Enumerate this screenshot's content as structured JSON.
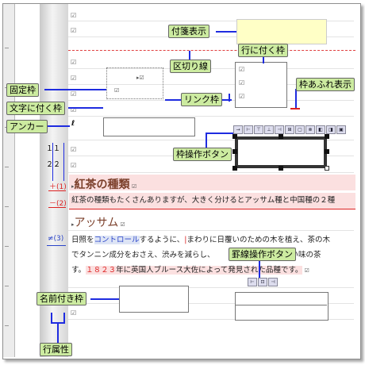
{
  "labels": {
    "sticky_note": "付箋表示",
    "separator_line": "区切り線",
    "row_frame": "行に付く枠",
    "fixed_frame": "固定枠",
    "link_frame": "リンク枠",
    "frame_overflow": "枠あふれ表示",
    "char_frame": "文字に付く枠",
    "anchor": "アンカー",
    "frame_ops_button": "枠操作ボタン",
    "ruled_ops_button": "罫線操作ボタン",
    "named_frame": "名前付き枠",
    "line_attr": "行属性"
  },
  "gutter": {
    "nums": [
      "１１",
      "２２"
    ],
    "marks": [
      "(1)",
      "(2)",
      "(3)"
    ],
    "mark_prefixes": [
      "＋",
      "－",
      "≠"
    ]
  },
  "doc": {
    "heading1": "紅茶の種類",
    "line1": "紅茶の種類もたくさんありますが、大きく分けるとアッサム種と中国種の２種",
    "heading2": "アッサム",
    "line2a": "日照を",
    "line2b": "コントロール",
    "line2c": "するように、",
    "line2d": "まわりに日覆いのための木を植え、茶の木",
    "line3": "でタンニン成分をおさえ、渋みを減らし、",
    "line3b": "のある濃い味の茶",
    "line4a": "す。",
    "line4b": "１８２３",
    "line4c": "年に英国人ブルース大佐によって発見された品種です。"
  },
  "colors": {
    "label_bg": "#cceba0",
    "arrow": "#1f2ce0",
    "note_bg": "#ffffc6",
    "heading": "#7b3f2a",
    "highlight": "#fbe0e0"
  }
}
